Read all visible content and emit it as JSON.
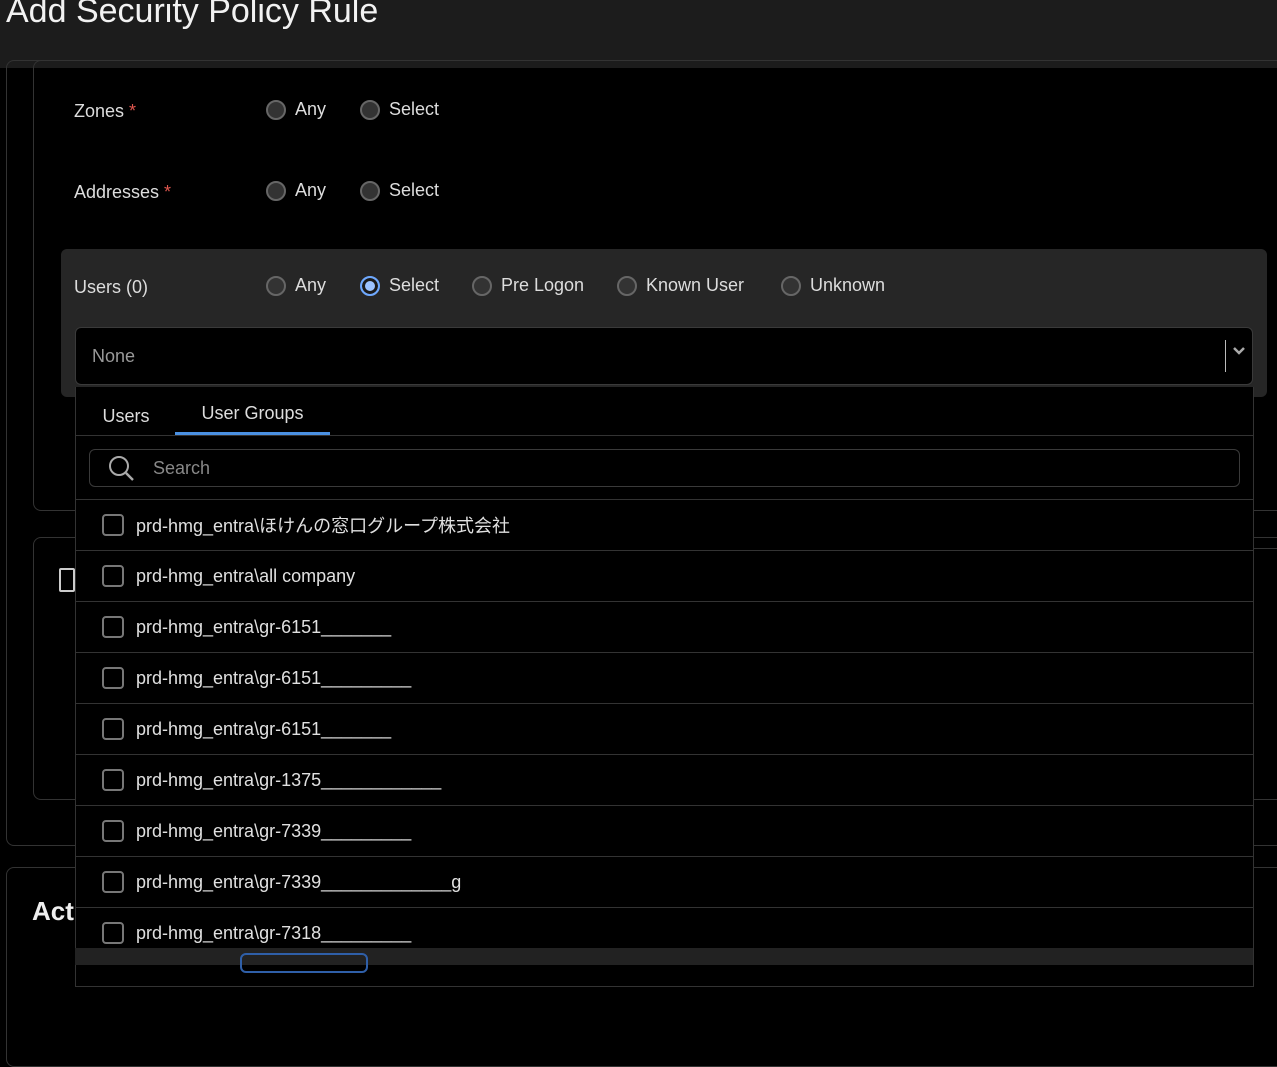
{
  "header": {
    "title": "Add Security Policy Rule"
  },
  "form": {
    "zones": {
      "label": "Zones",
      "required": "*",
      "options": [
        "Any",
        "Select"
      ]
    },
    "addresses": {
      "label": "Addresses",
      "required": "*",
      "options": [
        "Any",
        "Select"
      ]
    },
    "users": {
      "label": "Users (0)",
      "options": [
        "Any",
        "Select",
        "Pre Logon",
        "Known User",
        "Unknown"
      ],
      "selected": "Select"
    }
  },
  "dropdown": {
    "value": "None"
  },
  "popup": {
    "tabs": [
      "Users",
      "User Groups"
    ],
    "active_tab": "User Groups",
    "search_placeholder": "Search",
    "items": [
      "prd-hmg_entra\\ほけんの窓口グループ株式会社",
      "prd-hmg_entra\\all company",
      "prd-hmg_entra\\gr-6151_______",
      "prd-hmg_entra\\gr-6151_________",
      "prd-hmg_entra\\gr-6151_______",
      "prd-hmg_entra\\gr-1375____________",
      "prd-hmg_entra\\gr-7339_________",
      "prd-hmg_entra\\gr-7339_____________g",
      "prd-hmg_entra\\gr-7318_________"
    ]
  },
  "actions_section": {
    "label_partial": "Act"
  },
  "colors": {
    "accent": "#4a90e2",
    "required": "#e0574f"
  }
}
